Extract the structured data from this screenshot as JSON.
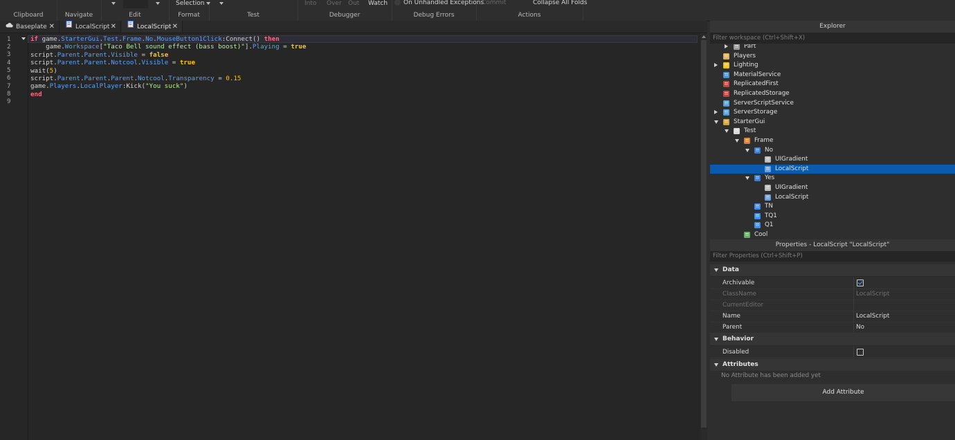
{
  "ribbon": {
    "groups": {
      "clipboard": "Clipboard",
      "navigate": "Navigate",
      "edit": "Edit",
      "format": "Format",
      "test": "Test",
      "debugger": "Debugger",
      "debug_errors": "Debug Errors",
      "actions": "Actions"
    },
    "selection_label": "Selection",
    "into_label": "Into",
    "over_label": "Over",
    "out_label": "Out",
    "watch_label": "Watch",
    "on_unhandled_label": "On Unhandled Exceptions",
    "commit_label": "Commit",
    "collapse_label": "Collapse All Folds"
  },
  "tabs": [
    {
      "label": "Baseplate",
      "icon": "cloud-icon"
    },
    {
      "label": "LocalScript",
      "icon": "script-icon"
    },
    {
      "label": "LocalScript",
      "icon": "script-icon",
      "active": true
    }
  ],
  "editor": {
    "line_numbers": [
      "1",
      "2",
      "3",
      "4",
      "5",
      "6",
      "7",
      "8",
      "9"
    ],
    "lines": [
      [
        {
          "t": "if",
          "c": "kw"
        },
        {
          "t": " game."
        },
        {
          "t": "StarterGui",
          "c": "prop"
        },
        {
          "t": "."
        },
        {
          "t": "Test",
          "c": "prop"
        },
        {
          "t": "."
        },
        {
          "t": "Frame",
          "c": "prop"
        },
        {
          "t": "."
        },
        {
          "t": "No",
          "c": "prop"
        },
        {
          "t": "."
        },
        {
          "t": "MouseButton1Click",
          "c": "prop"
        },
        {
          "t": ":Connect() "
        },
        {
          "t": "then",
          "c": "kw"
        }
      ],
      [
        {
          "t": "    game."
        },
        {
          "t": "Workspace",
          "c": "prop"
        },
        {
          "t": "["
        },
        {
          "t": "\"Taco Bell sound effect (bass boost)\"",
          "c": "str"
        },
        {
          "t": "]."
        },
        {
          "t": "Playing",
          "c": "prop"
        },
        {
          "t": " = "
        },
        {
          "t": "true",
          "c": "bool"
        }
      ],
      [
        {
          "t": "script."
        },
        {
          "t": "Parent",
          "c": "prop"
        },
        {
          "t": "."
        },
        {
          "t": "Parent",
          "c": "prop"
        },
        {
          "t": "."
        },
        {
          "t": "Visible",
          "c": "prop"
        },
        {
          "t": " = "
        },
        {
          "t": "false",
          "c": "bool"
        }
      ],
      [
        {
          "t": "script."
        },
        {
          "t": "Parent",
          "c": "prop"
        },
        {
          "t": "."
        },
        {
          "t": "Parent",
          "c": "prop"
        },
        {
          "t": "."
        },
        {
          "t": "Notcool",
          "c": "prop"
        },
        {
          "t": "."
        },
        {
          "t": "Visible",
          "c": "prop"
        },
        {
          "t": " = "
        },
        {
          "t": "true",
          "c": "bool"
        }
      ],
      [
        {
          "t": "wait("
        },
        {
          "t": "5",
          "c": "num"
        },
        {
          "t": ")"
        }
      ],
      [
        {
          "t": "script."
        },
        {
          "t": "Parent",
          "c": "prop"
        },
        {
          "t": "."
        },
        {
          "t": "Parent",
          "c": "prop"
        },
        {
          "t": "."
        },
        {
          "t": "Parent",
          "c": "prop"
        },
        {
          "t": "."
        },
        {
          "t": "Notcool",
          "c": "prop"
        },
        {
          "t": "."
        },
        {
          "t": "Transparency",
          "c": "prop"
        },
        {
          "t": " = "
        },
        {
          "t": "0.15",
          "c": "num"
        }
      ],
      [
        {
          "t": "game."
        },
        {
          "t": "Players",
          "c": "prop"
        },
        {
          "t": "."
        },
        {
          "t": "LocalPlayer",
          "c": "prop"
        },
        {
          "t": ":Kick("
        },
        {
          "t": "\"You suck\"",
          "c": "str"
        },
        {
          "t": ")"
        }
      ],
      [
        {
          "t": "end",
          "c": "kw"
        }
      ],
      []
    ]
  },
  "explorer": {
    "title": "Explorer",
    "filter_placeholder": "Filter workspace (Ctrl+Shift+X)",
    "items": [
      {
        "label": "Part",
        "depth": 1,
        "arrow": "right",
        "icon": "part-icon",
        "color": "#9a9a9a"
      },
      {
        "label": "Players",
        "depth": 0,
        "arrow": "",
        "icon": "players-icon",
        "color": "#e0b060"
      },
      {
        "label": "Lighting",
        "depth": 0,
        "arrow": "right",
        "icon": "lighting-icon",
        "color": "#f0c020"
      },
      {
        "label": "MaterialService",
        "depth": 0,
        "arrow": "",
        "icon": "material-service-icon",
        "color": "#4a8fd0"
      },
      {
        "label": "ReplicatedFirst",
        "depth": 0,
        "arrow": "",
        "icon": "replicated-first-icon",
        "color": "#d04040"
      },
      {
        "label": "ReplicatedStorage",
        "depth": 0,
        "arrow": "",
        "icon": "replicated-storage-icon",
        "color": "#d04040"
      },
      {
        "label": "ServerScriptService",
        "depth": 0,
        "arrow": "",
        "icon": "server-script-service-icon",
        "color": "#50a0e0"
      },
      {
        "label": "ServerStorage",
        "depth": 0,
        "arrow": "right",
        "icon": "server-storage-icon",
        "color": "#50a0e0"
      },
      {
        "label": "StarterGui",
        "depth": 0,
        "arrow": "down",
        "icon": "starter-gui-icon",
        "color": "#d8a040"
      },
      {
        "label": "Test",
        "depth": 1,
        "arrow": "down",
        "icon": "screen-gui-icon",
        "color": "#d8d8d8"
      },
      {
        "label": "Frame",
        "depth": 2,
        "arrow": "down",
        "icon": "frame-icon",
        "color": "#e08030"
      },
      {
        "label": "No",
        "depth": 3,
        "arrow": "down",
        "icon": "text-button-icon",
        "color": "#3a7fd0"
      },
      {
        "label": "UIGradient",
        "depth": 4,
        "arrow": "",
        "icon": "ui-gradient-icon",
        "color": "#bbbbbb"
      },
      {
        "label": "LocalScript",
        "depth": 4,
        "arrow": "",
        "icon": "local-script-icon",
        "color": "#6aa0e0",
        "selected": true
      },
      {
        "label": "Yes",
        "depth": 3,
        "arrow": "down",
        "icon": "text-button-icon",
        "color": "#3a7fd0"
      },
      {
        "label": "UIGradient",
        "depth": 4,
        "arrow": "",
        "icon": "ui-gradient-icon",
        "color": "#bbbbbb"
      },
      {
        "label": "LocalScript",
        "depth": 4,
        "arrow": "",
        "icon": "local-script-icon",
        "color": "#6aa0e0"
      },
      {
        "label": "TN",
        "depth": 3,
        "arrow": "",
        "icon": "text-label-icon",
        "color": "#3a8ff0"
      },
      {
        "label": "TQ1",
        "depth": 3,
        "arrow": "",
        "icon": "text-label-icon",
        "color": "#3a8ff0"
      },
      {
        "label": "Q1",
        "depth": 3,
        "arrow": "",
        "icon": "text-label-icon",
        "color": "#3a8ff0"
      },
      {
        "label": "Cool",
        "depth": 2,
        "arrow": "",
        "icon": "frame-icon",
        "color": "#60b060"
      }
    ]
  },
  "properties": {
    "title": "Properties - LocalScript \"LocalScript\"",
    "filter_placeholder": "Filter Properties (Ctrl+Shift+P)",
    "data_category": "Data",
    "archivable_label": "Archivable",
    "archivable_checked": true,
    "classname_label": "ClassName",
    "classname_value": "LocalScript",
    "currenteditor_label": "CurrentEditor",
    "name_label": "Name",
    "name_value": "LocalScript",
    "parent_label": "Parent",
    "parent_value": "No",
    "behavior_category": "Behavior",
    "disabled_label": "Disabled",
    "disabled_checked": false,
    "attributes_category": "Attributes",
    "no_attribute_text": "No Attribute has been added yet",
    "add_attribute_label": "Add Attribute"
  }
}
